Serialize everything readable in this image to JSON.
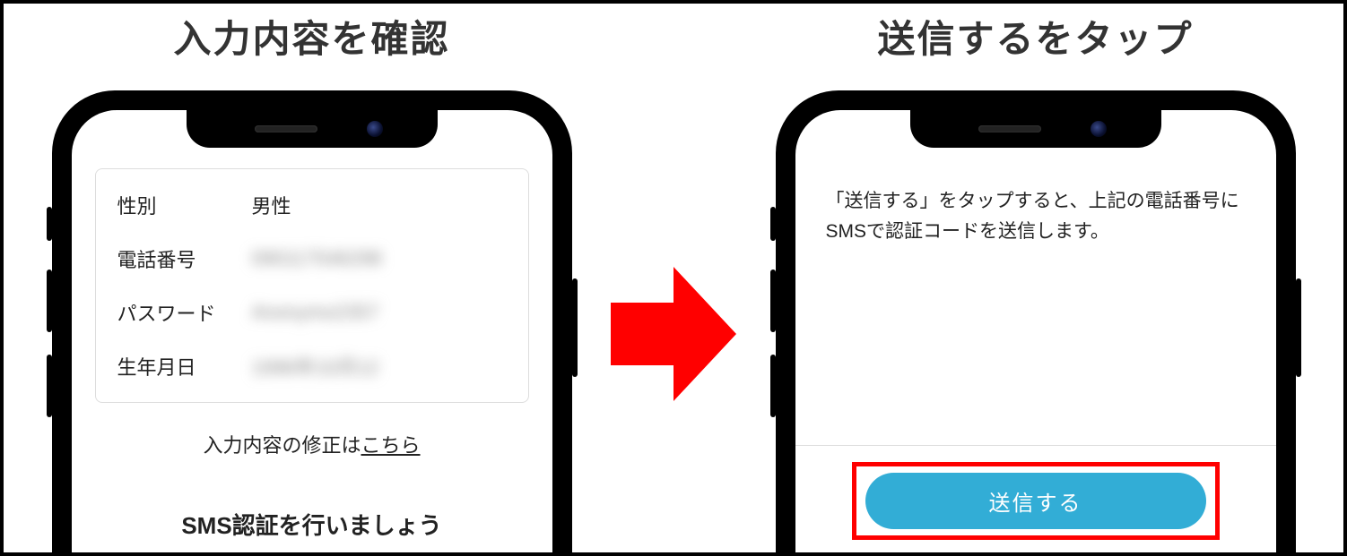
{
  "step1": {
    "title": "入力内容を確認",
    "rows": {
      "gender": {
        "label": "性別",
        "value": "男性",
        "blurred": false
      },
      "phone": {
        "label": "電話番号",
        "value": "090117546298",
        "blurred": true
      },
      "password": {
        "label": "パスワード",
        "value": "Anonymo2357",
        "blurred": true
      },
      "birthday": {
        "label": "生年月日",
        "value": "1996年10月12",
        "blurred": true
      }
    },
    "edit_prefix": "入力内容の修正は",
    "edit_link": "こちら",
    "sms_heading": "SMS認証を行いましょう"
  },
  "step2": {
    "title": "送信するをタップ",
    "info_text": "「送信する」をタップすると、上記の電話番号にSMSで認証コードを送信します。",
    "send_label": "送信する"
  },
  "colors": {
    "accent_red": "#ff0000",
    "button_blue": "#32add6"
  }
}
